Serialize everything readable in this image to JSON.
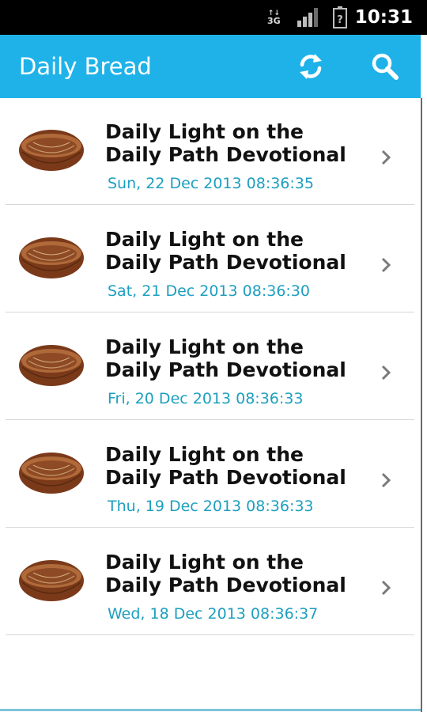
{
  "status_bar": {
    "network": "3G",
    "time": "10:31",
    "icons": [
      "network-3g-icon",
      "signal-icon",
      "battery-icon"
    ]
  },
  "app_bar": {
    "title": "Daily Bread",
    "actions": [
      "refresh-icon",
      "search-icon"
    ],
    "color": "#1fb2e9"
  },
  "feed": {
    "items": [
      {
        "title": "Daily Light on the Daily Path Devotional",
        "date": "Sun, 22 Dec 2013 08:36:35",
        "thumbnail": "bowl-thumbnail-icon"
      },
      {
        "title": "Daily Light on the Daily Path Devotional",
        "date": "Sat, 21 Dec 2013 08:36:30",
        "thumbnail": "bowl-thumbnail-icon"
      },
      {
        "title": "Daily Light on the Daily Path Devotional",
        "date": "Fri, 20 Dec 2013 08:36:33",
        "thumbnail": "bowl-thumbnail-icon"
      },
      {
        "title": "Daily Light on the Daily Path Devotional",
        "date": "Thu, 19 Dec 2013 08:36:33",
        "thumbnail": "bowl-thumbnail-icon"
      },
      {
        "title": "Daily Light on the Daily Path Devotional",
        "date": "Wed, 18 Dec 2013 08:36:37",
        "thumbnail": "bowl-thumbnail-icon"
      }
    ],
    "date_color": "#1d9fbf"
  }
}
